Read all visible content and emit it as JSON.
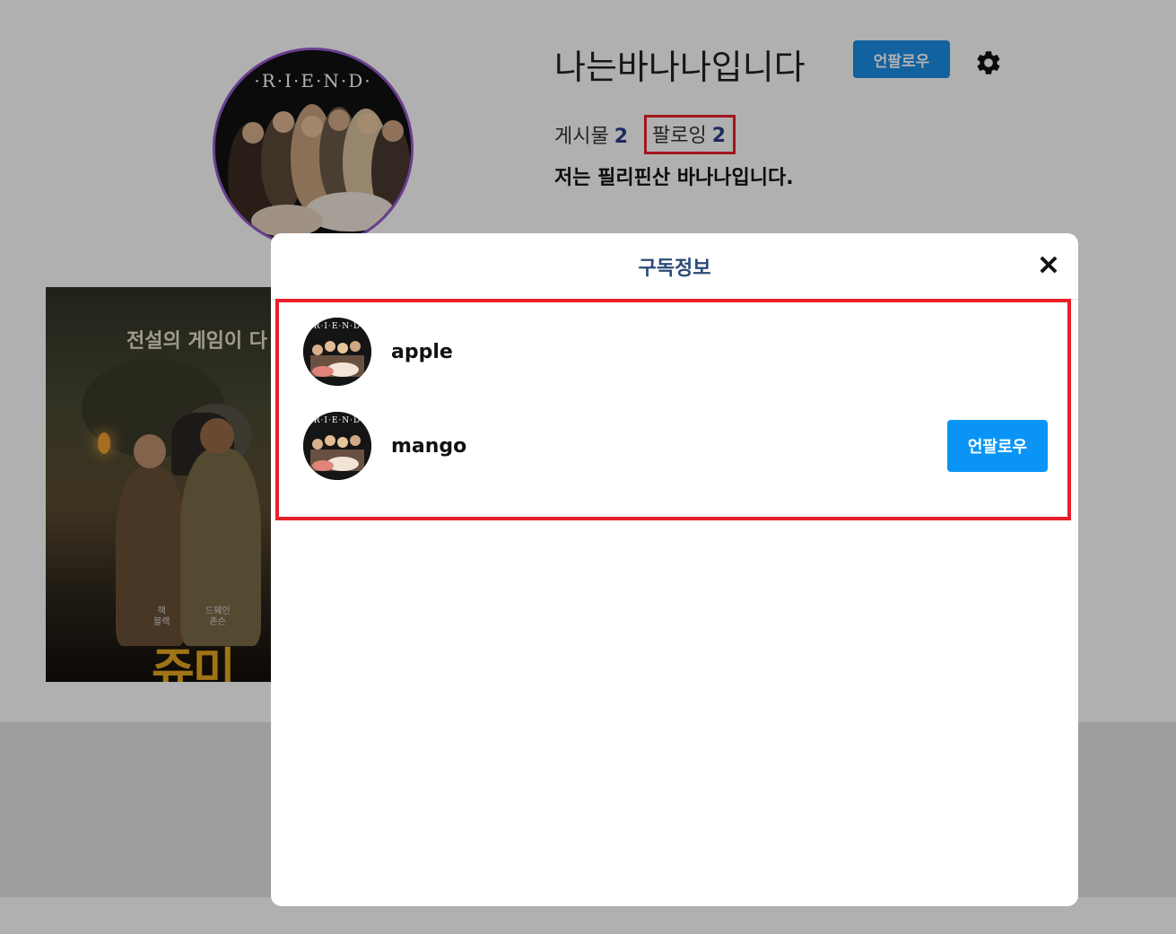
{
  "profile": {
    "username": "나는바나나입니다",
    "unfollow_label": "언팔로우",
    "avatar_logo": "·R·I·E·N·D·",
    "stats": {
      "posts_label": "게시물",
      "posts_count": "2",
      "following_label": "팔로잉",
      "following_count": "2"
    },
    "bio": "저는 필리핀산 바나나입니다."
  },
  "post": {
    "tagline": "전설의 게임이 다",
    "title_partial": "쥬미",
    "cast_1_role": "잭",
    "cast_1_name": "블랙",
    "cast_2_role": "드웨인",
    "cast_2_name": "존슨"
  },
  "modal": {
    "title": "구독정보",
    "close_glyph": "✕",
    "items": [
      {
        "name": "apple",
        "avatar_logo": "·R·I·E·N·D·"
      },
      {
        "name": "mango",
        "avatar_logo": "·R·I·E·N·D·",
        "unfollow_label": "언팔로우"
      }
    ]
  },
  "colors": {
    "accent": "#0a95f6",
    "highlight": "#e8202a",
    "avatar_ring": "#9b59d0",
    "stat_number": "#2b3f8c",
    "modal_title": "#2b4a7a"
  }
}
